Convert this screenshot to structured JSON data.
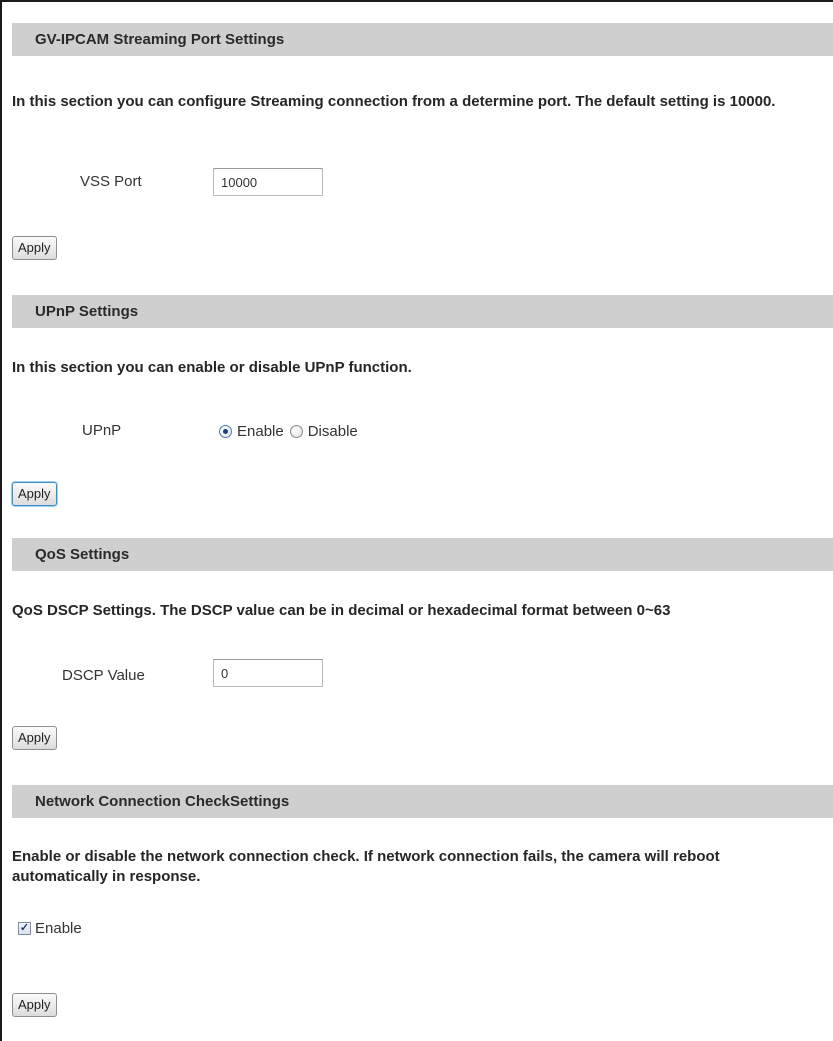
{
  "sections": {
    "streaming": {
      "title": "GV-IPCAM Streaming Port Settings",
      "description": "In this section you can configure Streaming connection from a determine port. The default setting is 10000.",
      "vss_port_label": "VSS Port",
      "vss_port_value": "10000",
      "apply_label": "Apply"
    },
    "upnp": {
      "title": "UPnP Settings",
      "description": "In this section you can enable or disable UPnP function.",
      "upnp_label": "UPnP",
      "enable_label": "Enable",
      "disable_label": "Disable",
      "selected": "Enable",
      "apply_label": "Apply"
    },
    "qos": {
      "title": "QoS Settings",
      "description": "QoS DSCP Settings. The DSCP value can be in decimal or hexadecimal format between 0~63",
      "dscp_label": "DSCP Value",
      "dscp_value": "0",
      "apply_label": "Apply"
    },
    "network_check": {
      "title": "Network Connection CheckSettings",
      "description": "Enable or disable the network connection check. If network connection fails, the camera will reboot automatically in response.",
      "enable_label": "Enable",
      "enable_checked": true,
      "apply_label": "Apply"
    }
  },
  "colors": {
    "header_bg": "#cfcfcf",
    "radio_dot": "#1b3f7a",
    "focus_border": "#3c8fc8"
  }
}
